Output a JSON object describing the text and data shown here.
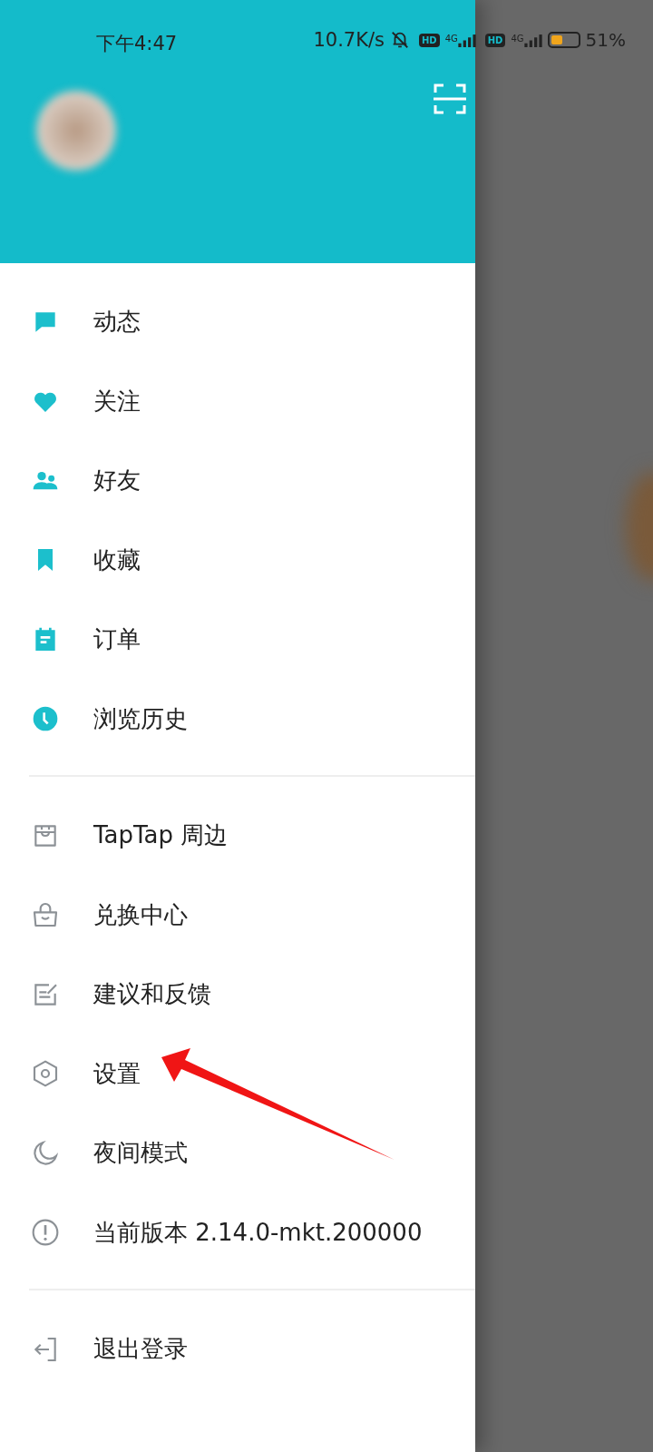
{
  "status_bar": {
    "time": "下午4:47",
    "net_speed": "10.7K/s",
    "sims": [
      {
        "badge": "HD",
        "network": "4G"
      },
      {
        "badge": "HD",
        "network": "4G"
      }
    ],
    "battery": "51%"
  },
  "drawer": {
    "sections": [
      {
        "kind": "accent",
        "items": [
          {
            "label": "动态"
          },
          {
            "label": "关注"
          },
          {
            "label": "好友"
          },
          {
            "label": "收藏"
          },
          {
            "label": "订单"
          },
          {
            "label": "浏览历史"
          }
        ]
      },
      {
        "kind": "plain",
        "items": [
          {
            "label": "TapTap 周边"
          },
          {
            "label": "兑换中心"
          },
          {
            "label": "建议和反馈"
          },
          {
            "label": "设置"
          },
          {
            "label": "夜间模式"
          },
          {
            "label": "当前版本 2.14.0-mkt.200000"
          }
        ]
      },
      {
        "kind": "plain",
        "items": [
          {
            "label": "退出登录"
          }
        ]
      }
    ]
  }
}
